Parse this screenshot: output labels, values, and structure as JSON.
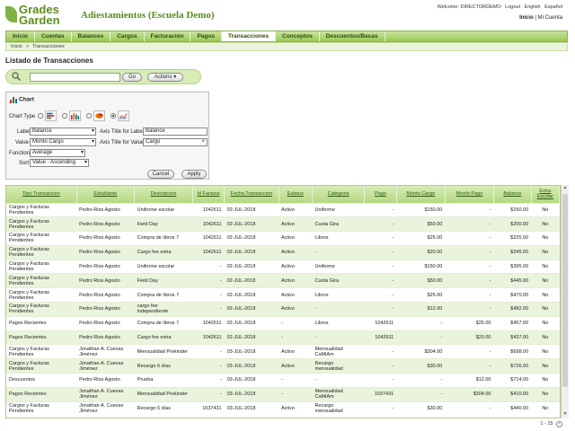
{
  "brand": {
    "line1": "Grades",
    "line2": "Garden"
  },
  "school_title": "Adiestamientos (Escuela Demo)",
  "welcome": {
    "text": "Welcome: DIRECTORDEMO",
    "logout": "Logout",
    "english": "English",
    "spanish": "Español"
  },
  "toplinks": {
    "inicio": "Inicio",
    "sep": "|",
    "cuenta": "Mi Cuenta"
  },
  "nav": [
    "Inicio",
    "Cuentas",
    "Balances",
    "Cargos",
    "Facturación",
    "Pagos",
    "Transacciones",
    "Conceptos",
    "Descuentos/Becas"
  ],
  "nav_active": "Transacciones",
  "breadcrumb": {
    "home": "Inicio",
    "sep": ">",
    "current": "Transacciones"
  },
  "page_title": "Listado de Transacciones",
  "search": {
    "value": "",
    "go": "Go",
    "actions": "Actions"
  },
  "chart_panel": {
    "title": "Chart",
    "chart_type_label": "Chart Type",
    "label_label": "Label",
    "label_value": "Balance",
    "axis_label_label": "Axis Title for Label",
    "axis_label_value": "Balance",
    "value_label": "Value",
    "value_value": "Monto Cargo",
    "axis_value_label": "Axis Title for Value",
    "axis_value_value": "Cargo",
    "function_label": "Function",
    "function_value": "Average",
    "sort_label": "Sort",
    "sort_value": "Value - Ascending",
    "cancel": "Cancel",
    "apply": "Apply"
  },
  "table": {
    "headers": [
      "Tipo Transaccion",
      "Estudiante",
      "Descripcion",
      "Id Factura",
      "Fecha Transaccion",
      "Estatus",
      "Categoria",
      "Pago",
      "Monto Cargo",
      "Monto Pago",
      "Balance",
      "Extra Escolar"
    ],
    "rows": [
      [
        "Cargos y Facturas Pendientes",
        "Pedro Rios Agosto",
        "Uniforme escolar",
        "1042611",
        "02-JUL-2018",
        "Activo",
        "Uniforme",
        "-",
        "$150.00",
        "-",
        "$150.00",
        "No"
      ],
      [
        "Cargos y Facturas Pendientes",
        "Pedro Rios Agosto",
        "Field Day",
        "1042611",
        "02-JUL-2018",
        "Activo",
        "Cuota Gira",
        "-",
        "$50.00",
        "-",
        "$200.00",
        "No"
      ],
      [
        "Cargos y Facturas Pendientes",
        "Pedro Rios Agosto",
        "Compra de libros 7",
        "1042611",
        "02-JUL-2018",
        "Activo",
        "Libros",
        "-",
        "$25.00",
        "-",
        "$225.00",
        "No"
      ],
      [
        "Cargos y Facturas Pendientes",
        "Pedro Rios Agosto",
        "Cargo fee extra",
        "1042611",
        "02-JUL-2018",
        "Activo",
        "-",
        "-",
        "$20.00",
        "-",
        "$245.00",
        "No"
      ],
      [
        "Cargos y Facturas Pendientes",
        "Pedro Rios Agosto",
        "Uniforme escolar",
        "-",
        "02-JUL-2018",
        "Activo",
        "Uniforme",
        "-",
        "$150.00",
        "-",
        "$395.00",
        "No"
      ],
      [
        "Cargos y Facturas Pendientes",
        "Pedro Rios Agosto",
        "Field Day",
        "-",
        "02-JUL-2018",
        "Activo",
        "Cuota Gira",
        "-",
        "$50.00",
        "-",
        "$445.00",
        "No"
      ],
      [
        "Cargos y Facturas Pendientes",
        "Pedro Rios Agosto",
        "Compra de libros 7",
        "-",
        "02-JUL-2018",
        "Activo",
        "Libros",
        "-",
        "$25.00",
        "-",
        "$470.00",
        "No"
      ],
      [
        "Cargos y Facturas Pendientes",
        "Pedro Rios Agosto",
        "cargo fee independiente",
        "-",
        "02-JUL-2018",
        "Activo",
        "-",
        "-",
        "$12.00",
        "-",
        "$482.00",
        "No"
      ],
      [
        "Pagos Recientes",
        "Pedro Rios Agosto",
        "Compra de libros 7",
        "1042611",
        "02-JUL-2018",
        "-",
        "Libros",
        "1042611",
        "-",
        "$25.00",
        "$457.00",
        "No"
      ],
      [
        "Pagos Recientes",
        "Pedro Rios Agosto",
        "Cargo fee extra",
        "1042611",
        "02-JUL-2018",
        "-",
        "-",
        "1042611",
        "-",
        "$20.00",
        "$437.00",
        "No"
      ],
      [
        "Cargos y Facturas Pendientes",
        "Jonathan A. Cuevas Jiménez",
        "Mensualidad Prekinder",
        "-",
        "03-JUL-2018",
        "Activo",
        "Mensualidad CaMiAm",
        "-",
        "$304.00",
        "-",
        "$698.00",
        "No"
      ],
      [
        "Cargos y Facturas Pendientes",
        "Jonathan A. Cuevas Jiménez",
        "Recargo 6 días",
        "-",
        "03-JUL-2018",
        "Activo",
        "Recargo mensualidad",
        "-",
        "$30.00",
        "-",
        "$726.00",
        "No"
      ],
      [
        "Descuentos",
        "Pedro Rios Agosto",
        "Prueba",
        "-",
        "03-JUL-2018",
        "-",
        "-",
        "-",
        "-",
        "$12.00",
        "$714.00",
        "No"
      ],
      [
        "Pagos Recientes",
        "Jonathan A. Cuevas Jiménez",
        "Mensualidad Prekinder",
        "-",
        "03-JUL-2018",
        "-",
        "Mensualidad CaMiAm",
        "1037431",
        "-",
        "$304.00",
        "$410.00",
        "No"
      ],
      [
        "Cargos y Facturas Pendientes",
        "Jonathan A. Cuevas Jiménez",
        "Recargo 6 días",
        "1037431",
        "03-JUL-2018",
        "Activo",
        "Recargo mensualidad",
        "-",
        "$30.00",
        "-",
        "$440.00",
        "No"
      ]
    ]
  },
  "pager": {
    "range": "1 - 15"
  }
}
